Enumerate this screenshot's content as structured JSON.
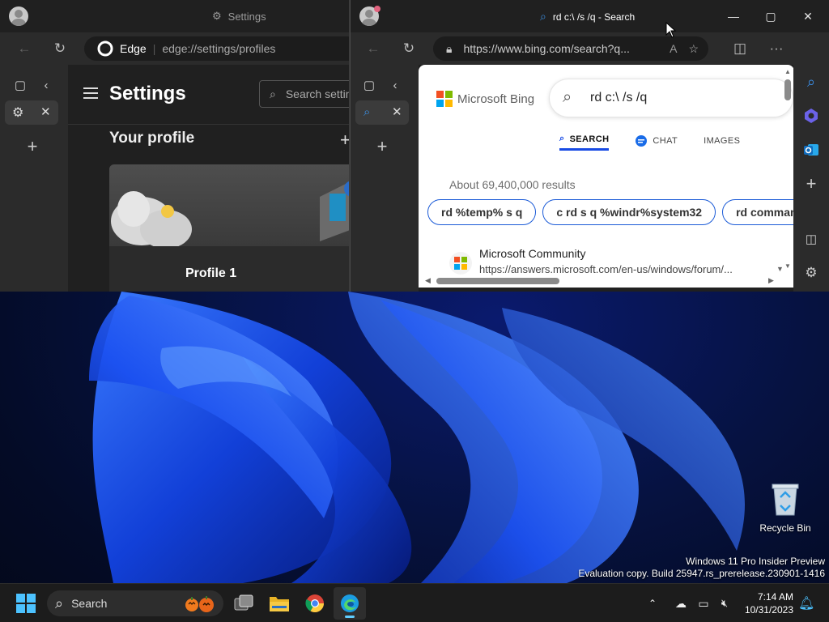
{
  "settings_window": {
    "title": "Settings",
    "tab_label": "Edge",
    "url": "edge://settings/profiles",
    "page_title": "Settings",
    "search_placeholder": "Search settings",
    "section_heading": "Your profile",
    "profile_name": "Profile 1"
  },
  "search_window": {
    "title": "rd c:\\ /s /q - Search",
    "url": "https://www.bing.com/search?q...",
    "bing": {
      "logo_text": "Microsoft Bing",
      "query": "rd c:\\ /s /q",
      "tabs": [
        "SEARCH",
        "CHAT",
        "IMAGES"
      ],
      "results_count": "About 69,400,000 results",
      "related_chips": [
        "rd %temp% s q",
        "c rd s q %windr%system32",
        "rd command"
      ],
      "result": {
        "site": "Microsoft Community",
        "url": "https://answers.microsoft.com/en-us/windows/forum/..."
      }
    }
  },
  "desktop": {
    "recycle_bin": "Recycle Bin",
    "watermark_line1": "Windows 11 Pro Insider Preview",
    "watermark_line2": "Evaluation copy. Build 25947.rs_prerelease.230901-1416"
  },
  "taskbar": {
    "search_label": "Search",
    "time": "7:14 AM",
    "date": "10/31/2023"
  },
  "colors": {
    "accent": "#60cdff",
    "bing_chip_border": "#1a5ad7",
    "bing_tab_underline": "#174ae4"
  }
}
